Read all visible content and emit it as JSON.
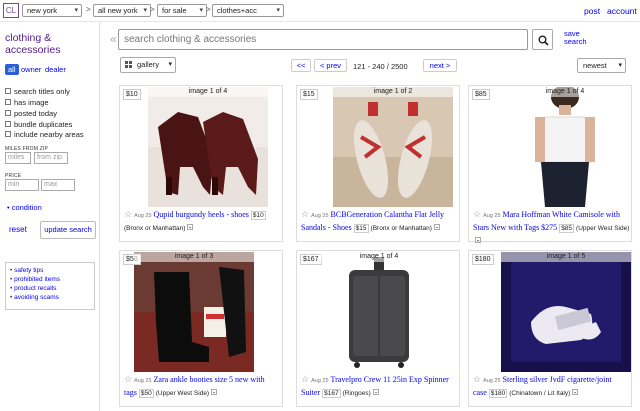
{
  "topbar": {
    "logo": "CL",
    "breadcrumbs": [
      "new york",
      "all new york",
      "for sale",
      "clothes+acc"
    ],
    "post_label": "post",
    "account_label": "account"
  },
  "sidebar": {
    "category_title": "clothing & accessories",
    "owner_filters": [
      "all",
      "owner",
      "dealer"
    ],
    "checkboxes": [
      "search titles only",
      "has image",
      "posted today",
      "bundle duplicates",
      "include nearby areas"
    ],
    "miles_label": "MILES FROM ZIP",
    "miles_placeholder": "miles",
    "zip_placeholder": "from zip",
    "price_label": "PRICE",
    "min_placeholder": "min",
    "max_placeholder": "max",
    "condition_label": "condition",
    "reset_label": "reset",
    "update_label": "update search",
    "help_links": [
      "safety tips",
      "prohibited items",
      "product recalls",
      "avoiding scams"
    ]
  },
  "search": {
    "placeholder": "search clothing & accessories",
    "save_label_1": "save",
    "save_label_2": "search"
  },
  "toolbar": {
    "view_label": "gallery",
    "first_label": "<<",
    "prev_label": "< prev",
    "range_label": "121 - 240 / 2500",
    "next_label": "next >",
    "sort_label": "newest"
  },
  "listings": [
    {
      "price": "$10",
      "image_counter": "image 1 of 4",
      "date": "Aug 25",
      "title": "Qupid burgundy heels - shoes",
      "price_tag": "$10",
      "hood": "(Bronx or Manhattan)"
    },
    {
      "price": "$15",
      "image_counter": "image 1 of 2",
      "date": "Aug 25",
      "title": "BCBGeneration Calantha Flat Jelly Sandals - Shoes",
      "price_tag": "$15",
      "hood": "(Bronx or Manhattan)"
    },
    {
      "price": "$85",
      "image_counter": "image 1 of 4",
      "date": "Aug 25",
      "title": "Mara Hoffman White Camisole with Stars New with Tags $275",
      "price_tag": "$85",
      "hood": "(Upper West Side)"
    },
    {
      "price": "$50",
      "image_counter": "image 1 of 3",
      "date": "Aug 25",
      "title": "Zara ankle booties size 5 new with tags",
      "price_tag": "$50",
      "hood": "(Upper West Side)"
    },
    {
      "price": "$167",
      "image_counter": "image 1 of 4",
      "date": "Aug 25",
      "title": "Travelpro Crew 11 25in Exp Spinner Suiter",
      "price_tag": "$167",
      "hood": "(Ringoes)"
    },
    {
      "price": "$180",
      "image_counter": "image 1 of 5",
      "date": "Aug 25",
      "title": "Sterling silver JvdF cigarette/joint case",
      "price_tag": "$180",
      "hood": "(Chinatown / Lit Italy)"
    }
  ]
}
